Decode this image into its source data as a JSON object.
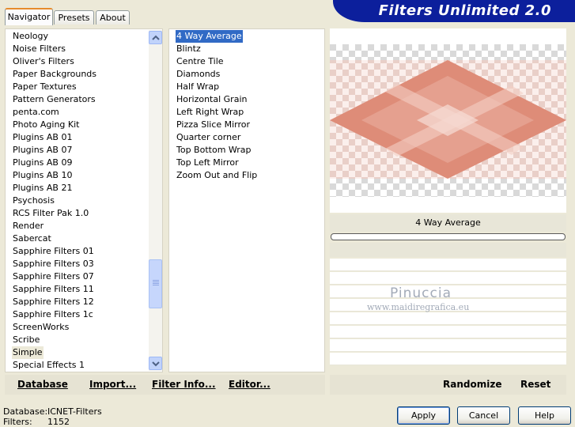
{
  "tabs": [
    {
      "label": "Navigator",
      "active": true
    },
    {
      "label": "Presets",
      "active": false
    },
    {
      "label": "About",
      "active": false
    }
  ],
  "banner": {
    "title": "Filters Unlimited 2.0"
  },
  "filter_categories": [
    "Neology",
    "Noise Filters",
    "Oliver's Filters",
    "Paper Backgrounds",
    "Paper Textures",
    "Pattern Generators",
    "penta.com",
    "Photo Aging Kit",
    "Plugins AB 01",
    "Plugins AB 07",
    "Plugins AB 09",
    "Plugins AB 10",
    "Plugins AB 21",
    "Psychosis",
    "RCS Filter Pak 1.0",
    "Render",
    "Sabercat",
    "Sapphire Filters 01",
    "Sapphire Filters 03",
    "Sapphire Filters 07",
    "Sapphire Filters 11",
    "Sapphire Filters 12",
    "Sapphire Filters 1c",
    "ScreenWorks",
    "Scribe",
    "Simple",
    "Special Effects 1"
  ],
  "selected_category": "Simple",
  "effects": [
    "4 Way Average",
    "Blintz",
    "Centre Tile",
    "Diamonds",
    "Half Wrap",
    "Horizontal Grain",
    "Left Right Wrap",
    "Pizza Slice Mirror",
    "Quarter corner",
    "Top Bottom Wrap",
    "Top Left Mirror",
    "Zoom Out and Flip"
  ],
  "selected_effect": "4 Way Average",
  "preview": {
    "effect_name": "4 Way Average",
    "accent": "#de8c78"
  },
  "watermark": {
    "name": "Pinuccia",
    "url": "www.maidiregrafica.eu"
  },
  "left_buttons": {
    "database": "Database",
    "import": "Import...",
    "filter_info": "Filter Info...",
    "editor": "Editor..."
  },
  "right_buttons": {
    "randomize": "Randomize",
    "reset": "Reset"
  },
  "status": {
    "database_label": "Database:",
    "database_value": "ICNET-Filters",
    "filters_label": "Filters:",
    "filters_value": "1152"
  },
  "dialog_buttons": {
    "apply": "Apply",
    "cancel": "Cancel",
    "help": "Help"
  },
  "icons": {
    "scroll_up": "chevron-up-icon",
    "scroll_down": "chevron-down-icon"
  },
  "colors": {
    "banner": "#0c1f9c",
    "selection": "#316ac5",
    "tab_highlight": "#e68b2c"
  }
}
